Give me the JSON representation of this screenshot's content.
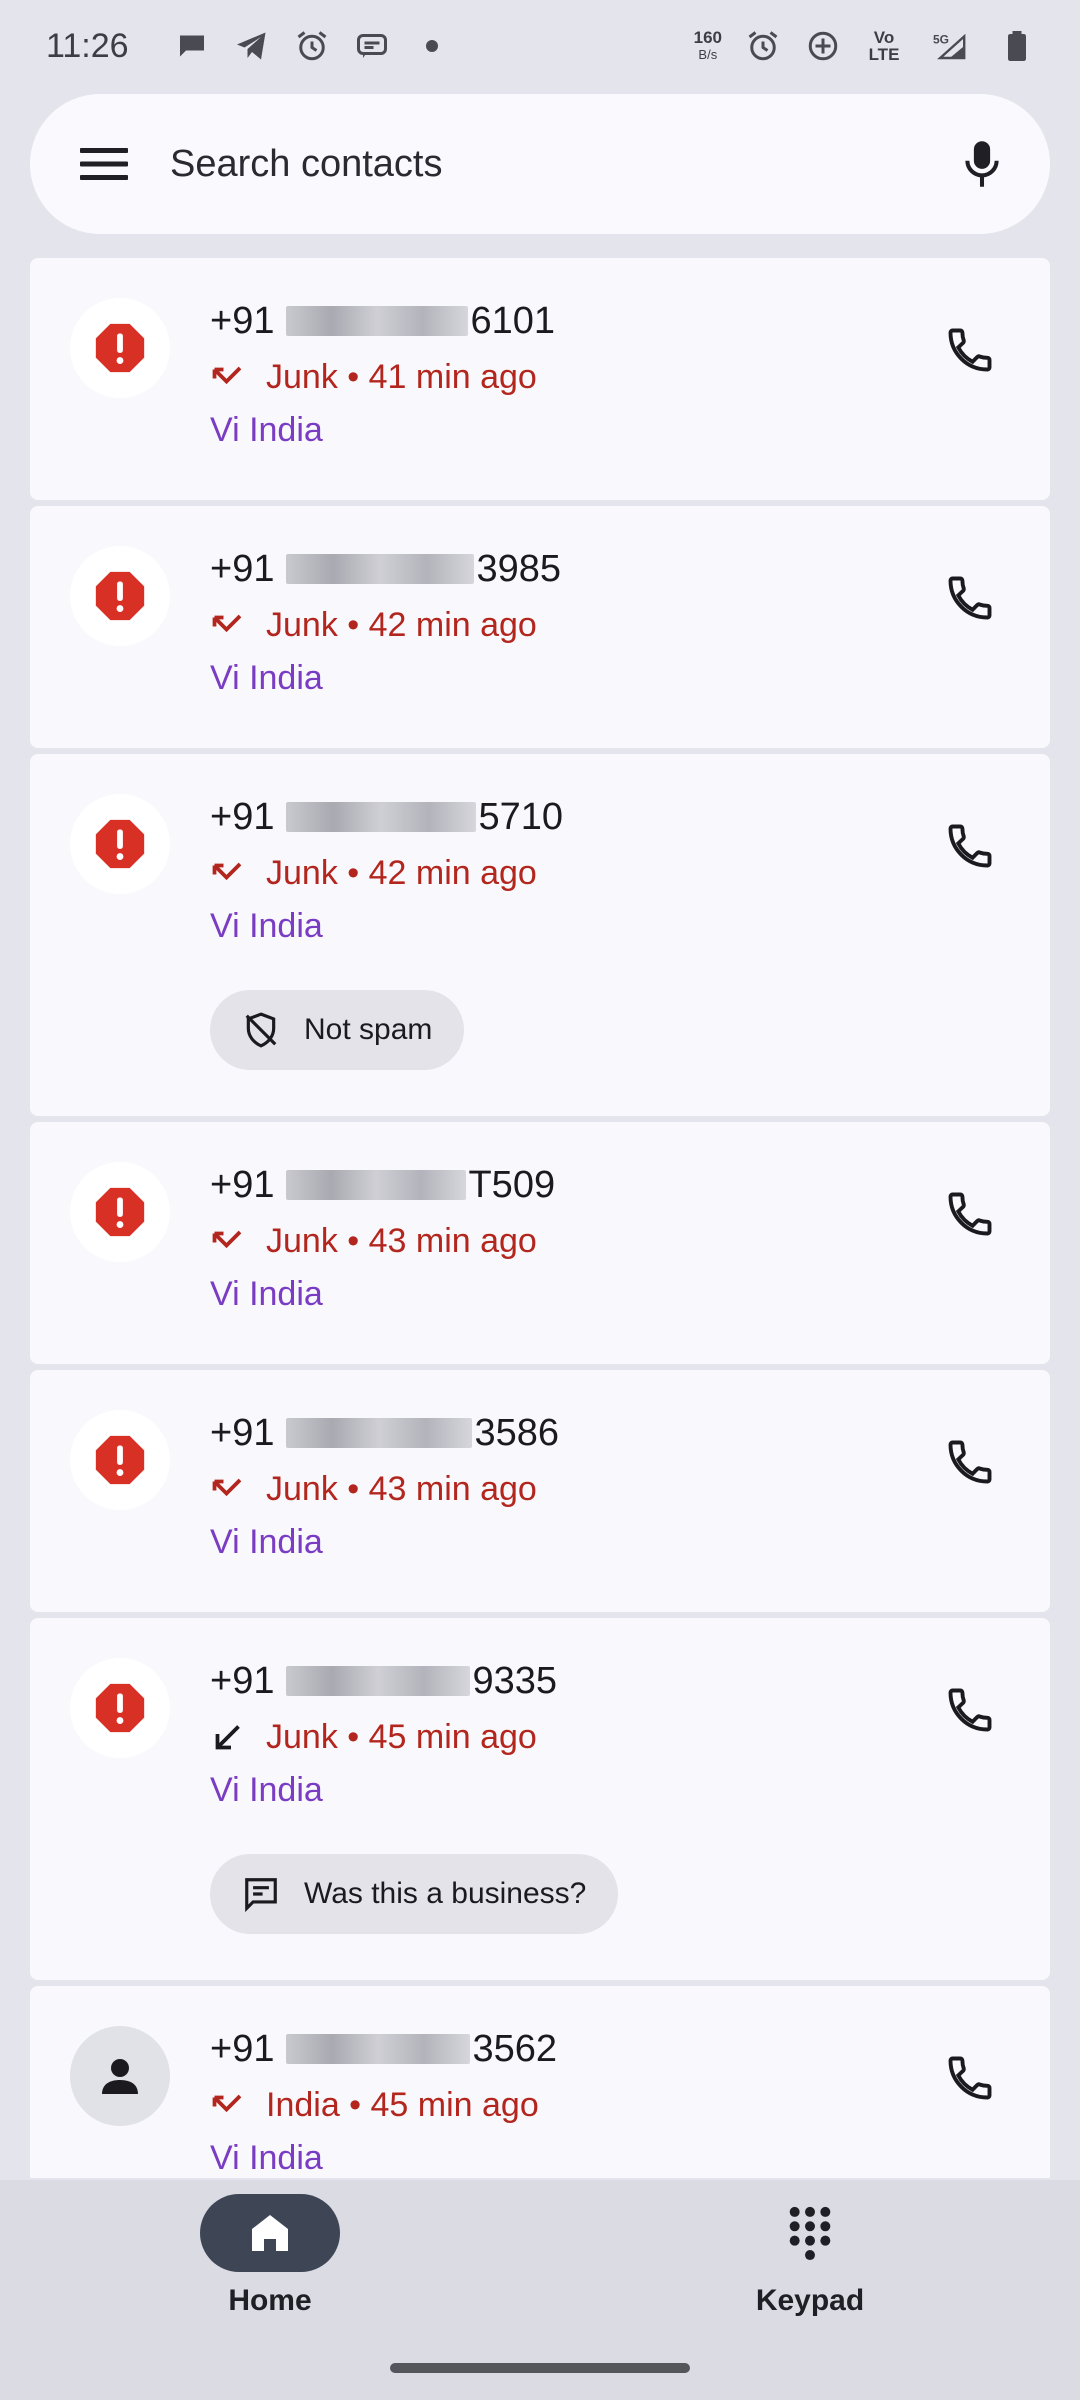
{
  "status_bar": {
    "time": "11:26",
    "speed_value": "160",
    "speed_unit": "B/s",
    "volte": "Vo LTE",
    "network": "5G"
  },
  "search": {
    "placeholder": "Search contacts"
  },
  "calls": [
    {
      "number_prefix": "+91",
      "number_suffix": "6101",
      "status": "Junk • 41 min ago",
      "carrier": "Vi India",
      "type": "missed"
    },
    {
      "number_prefix": "+91",
      "number_suffix": "3985",
      "status": "Junk • 42 min ago",
      "carrier": "Vi India",
      "type": "missed"
    },
    {
      "number_prefix": "+91",
      "number_suffix": "5710",
      "status": "Junk • 42 min ago",
      "carrier": "Vi India",
      "type": "missed",
      "chip": "Not spam"
    },
    {
      "number_prefix": "+91",
      "number_suffix": "T509",
      "status": "Junk • 43 min ago",
      "carrier": "Vi India",
      "type": "missed"
    },
    {
      "number_prefix": "+91",
      "number_suffix": "3586",
      "status": "Junk • 43 min ago",
      "carrier": "Vi India",
      "type": "missed"
    },
    {
      "number_prefix": "+91",
      "number_suffix": "9335",
      "status": "Junk • 45 min ago",
      "carrier": "Vi India",
      "type": "received",
      "chip": "Was this a business?"
    },
    {
      "number_prefix": "+91",
      "number_suffix": "3562",
      "status": "India • 45 min ago",
      "carrier": "Vi India",
      "type": "missed",
      "avatar": "person"
    }
  ],
  "nav": {
    "home_label": "Home",
    "keypad_label": "Keypad"
  },
  "colors": {
    "junk_red": "#b3261e",
    "carrier_purple": "#7a3cc2",
    "spam_icon": "#d93025"
  }
}
